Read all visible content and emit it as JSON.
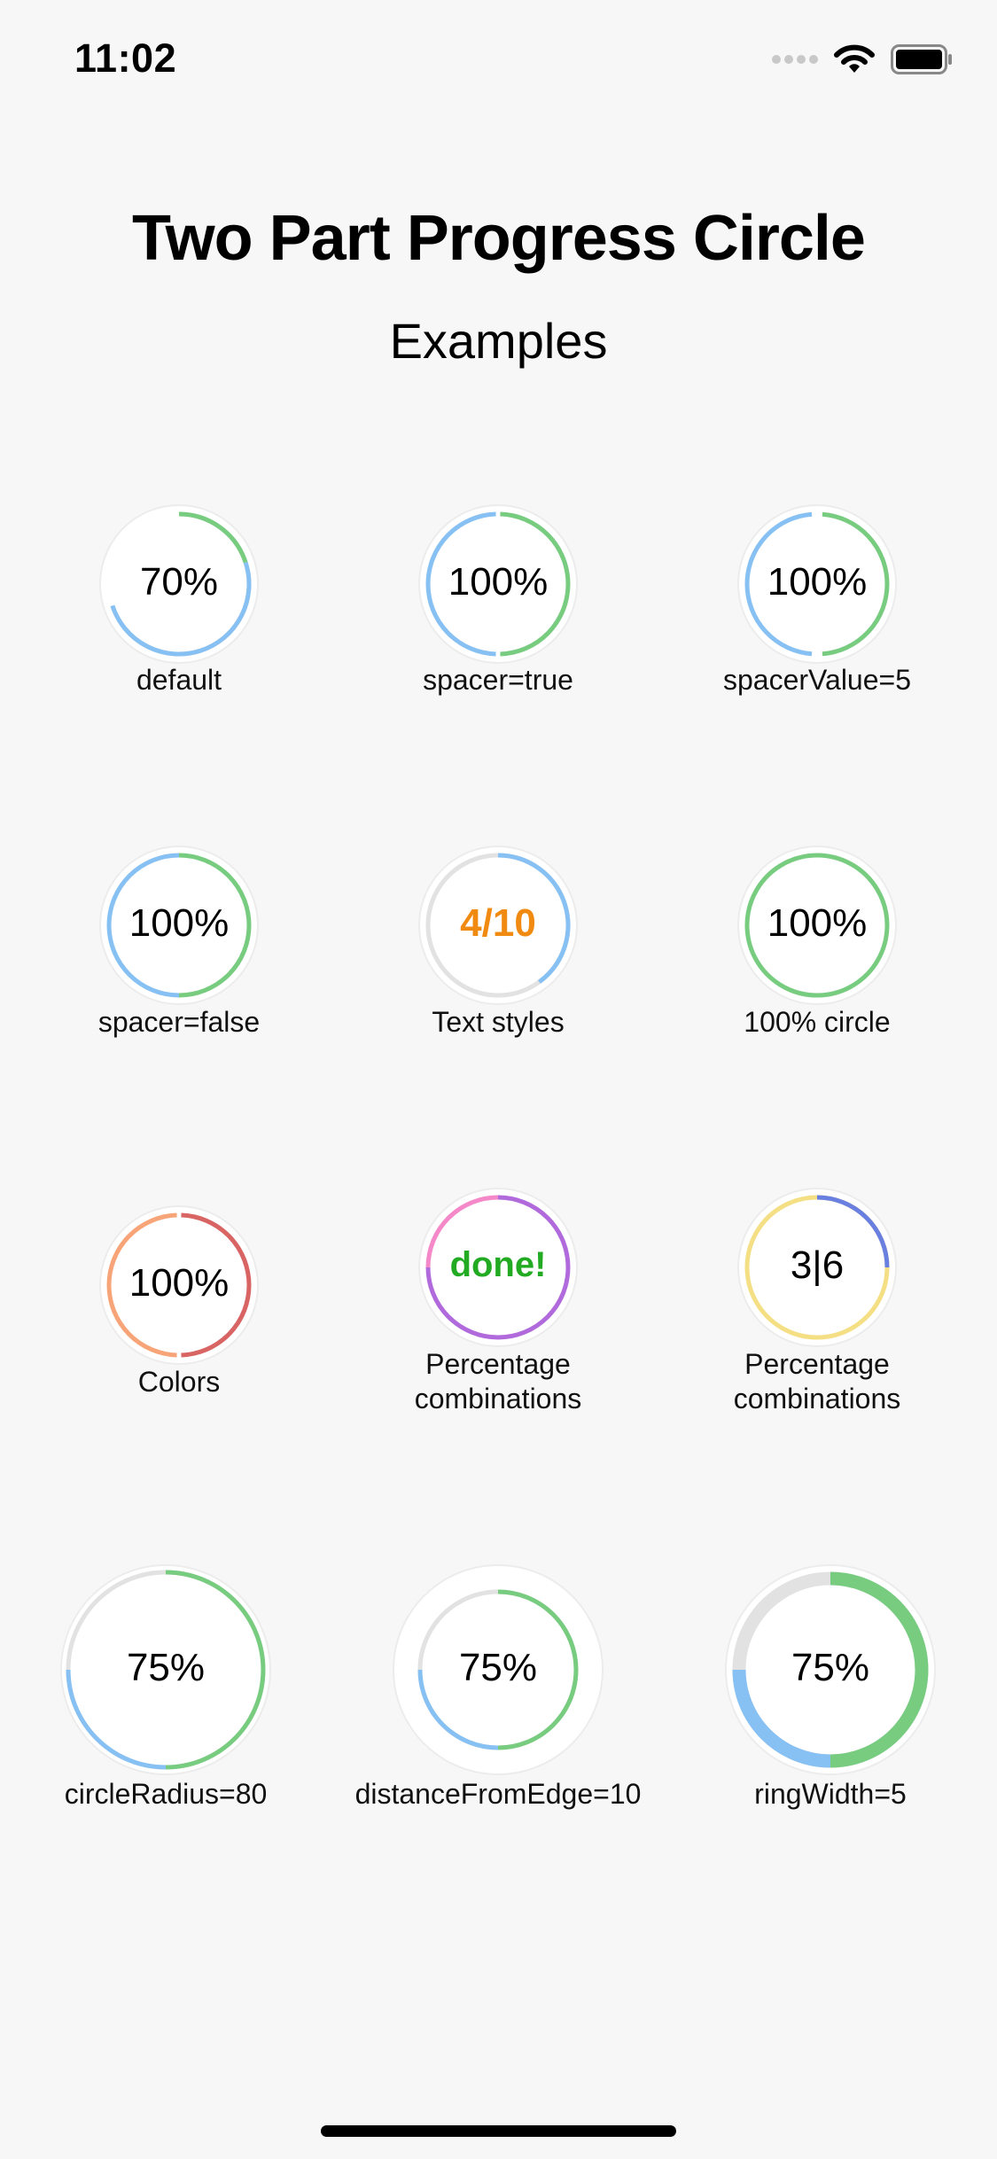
{
  "status_bar": {
    "time": "11:02",
    "icons": [
      "cellular-dots-icon",
      "wifi-icon",
      "battery-icon"
    ]
  },
  "header": {
    "title": "Two Part Progress Circle",
    "subtitle": "Examples"
  },
  "colors": {
    "green": "#78cc80",
    "blue": "#87c0f2",
    "track": "#e2e2e2",
    "orange": "#f18a10",
    "done_green": "#22aa22",
    "salmon": "#f7a578",
    "red": "#d86464",
    "pink": "#f488c8",
    "purple": "#b06adc",
    "indigo": "#6a80e0",
    "yellow": "#f5df85"
  },
  "examples": [
    {
      "label": "70%",
      "caption_lines": [
        "default"
      ],
      "progress": 0.7,
      "second_part": 0.5,
      "label_style": "normal"
    },
    {
      "label": "100%",
      "caption_lines": [
        "spacer=true"
      ],
      "progress": 1.0,
      "second_part": 0.5,
      "spacer": true,
      "label_style": "normal"
    },
    {
      "label": "100%",
      "caption_lines": [
        "spacerValue=5"
      ],
      "progress": 1.0,
      "second_part": 0.5,
      "spacer": true,
      "label_style": "normal"
    },
    {
      "label": "100%",
      "caption_lines": [
        "spacer=false"
      ],
      "progress": 1.0,
      "second_part": 0.5,
      "spacer": false,
      "label_style": "normal"
    },
    {
      "label": "4/10",
      "caption_lines": [
        "Text styles"
      ],
      "progress": 0.4,
      "second_part": 0.0,
      "label_style": "orange-bold"
    },
    {
      "label": "100%",
      "caption_lines": [
        "100% circle"
      ],
      "progress": 1.0,
      "second_part": 0.0,
      "label_style": "normal"
    },
    {
      "label": "100%",
      "caption_lines": [
        "Colors"
      ],
      "progress": 1.0,
      "second_part": 0.5,
      "label_style": "normal"
    },
    {
      "label": "done!",
      "caption_lines": [
        "Percentage",
        "combinations"
      ],
      "progress": 1.0,
      "second_part": 0.25,
      "label_style": "green-bold"
    },
    {
      "label": "3|6",
      "caption_lines": [
        "Percentage",
        "combinations"
      ],
      "progress": 0.5,
      "second_part": 0.25,
      "label_style": "normal"
    },
    {
      "label": "75%",
      "caption_lines": [
        "circleRadius=80"
      ],
      "progress": 0.75,
      "second_part": 0.25,
      "label_style": "normal"
    },
    {
      "label": "75%",
      "caption_lines": [
        "distanceFromEdge=10"
      ],
      "progress": 0.75,
      "second_part": 0.25,
      "label_style": "normal"
    },
    {
      "label": "75%",
      "caption_lines": [
        "ringWidth=5"
      ],
      "progress": 0.75,
      "second_part": 0.25,
      "label_style": "normal"
    }
  ]
}
